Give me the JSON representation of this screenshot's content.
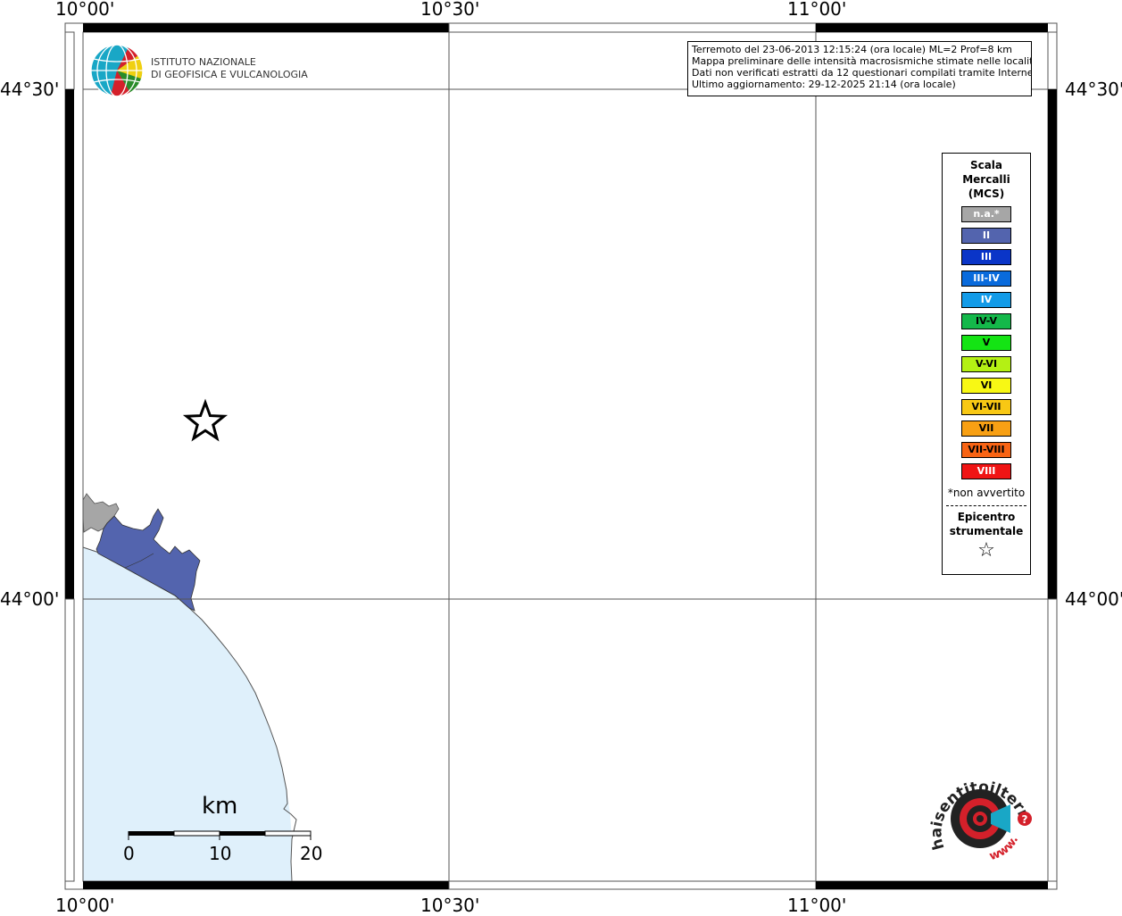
{
  "coordinates": {
    "lon_labels": [
      "10°00'",
      "10°30'",
      "11°00'"
    ],
    "lat_labels": [
      "44°30'",
      "44°00'"
    ]
  },
  "info_box": {
    "line1": "Terremoto del 23-06-2013 12:15:24 (ora locale) ML=2 Prof=8 km",
    "line2": "Mappa preliminare delle intensità macrosismiche stimate nelle località",
    "line3": "Dati non verificati estratti da 12 questionari compilati tramite Internet.",
    "line4": "Ultimo aggiornamento: 29-12-2025 21:14 (ora locale)"
  },
  "institute": {
    "line1": "ISTITUTO NAZIONALE",
    "line2": "DI GEOFISICA E VULCANOLOGIA"
  },
  "legend": {
    "title_line1": "Scala",
    "title_line2": "Mercalli",
    "title_line3": "(MCS)",
    "items": [
      {
        "label": "n.a.*",
        "color": "#a6a6a6"
      },
      {
        "label": "II",
        "color": "#5364ae"
      },
      {
        "label": "III",
        "color": "#0a35c8"
      },
      {
        "label": "III-IV",
        "color": "#0a6bdc"
      },
      {
        "label": "IV",
        "color": "#129be8"
      },
      {
        "label": "IV-V",
        "color": "#14b84a"
      },
      {
        "label": "V",
        "color": "#14e414"
      },
      {
        "label": "V-VI",
        "color": "#b4f014"
      },
      {
        "label": "VI",
        "color": "#f8f814"
      },
      {
        "label": "VI-VII",
        "color": "#f8c814"
      },
      {
        "label": "VII",
        "color": "#f8a014"
      },
      {
        "label": "VII-VIII",
        "color": "#f86414"
      },
      {
        "label": "VIII",
        "color": "#f01414"
      }
    ],
    "note": "*non avvertito",
    "epicentre_line1": "Epicentro",
    "epicentre_line2": "strumentale",
    "epicentre_symbol": "☆"
  },
  "scale_bar": {
    "unit": "km",
    "ticks": [
      "0",
      "10",
      "20"
    ]
  },
  "colors": {
    "sea": "#dff0fb",
    "intensity_ii": "#5364ae",
    "not_felt": "#a6a6a6"
  },
  "hsit": {
    "text": "haisentitoilterremoto.it",
    "www": "www.",
    "question_mark": "?"
  }
}
